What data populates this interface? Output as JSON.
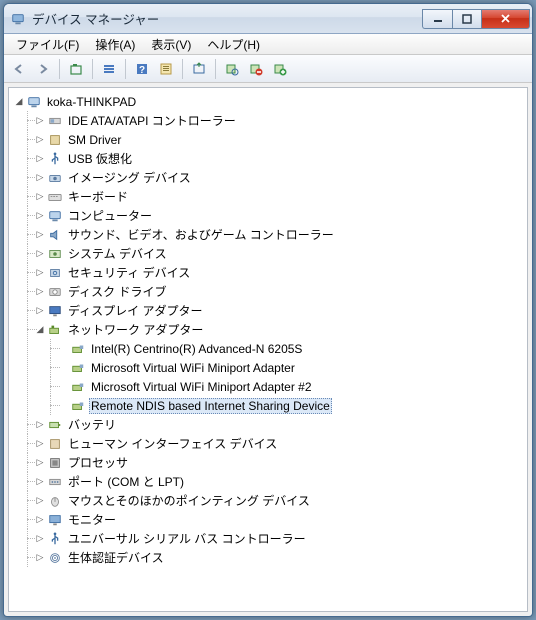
{
  "window": {
    "title": "デバイス マネージャー"
  },
  "menus": {
    "file": "ファイル(F)",
    "action": "操作(A)",
    "view": "表示(V)",
    "help": "ヘルプ(H)"
  },
  "toolbar_icons": [
    "back-icon",
    "forward-icon",
    "sep",
    "up-container-icon",
    "sep",
    "list-icon",
    "sep",
    "help-icon",
    "properties-icon",
    "sep",
    "refresh-icon",
    "sep",
    "scan-icon",
    "remove-icon",
    "add-icon"
  ],
  "tree": {
    "root": {
      "label": "koka-THINKPAD",
      "icon": "computer-icon",
      "expanded": true
    },
    "categories": [
      {
        "label": "IDE ATA/ATAPI コントローラー",
        "icon": "ide-icon"
      },
      {
        "label": "SM Driver",
        "icon": "sm-icon"
      },
      {
        "label": "USB 仮想化",
        "icon": "usb-icon"
      },
      {
        "label": "イメージング デバイス",
        "icon": "imaging-icon"
      },
      {
        "label": "キーボード",
        "icon": "keyboard-icon"
      },
      {
        "label": "コンピューター",
        "icon": "computer-icon"
      },
      {
        "label": "サウンド、ビデオ、およびゲーム コントローラー",
        "icon": "sound-icon"
      },
      {
        "label": "システム デバイス",
        "icon": "system-icon"
      },
      {
        "label": "セキュリティ デバイス",
        "icon": "security-icon"
      },
      {
        "label": "ディスク ドライブ",
        "icon": "disk-icon"
      },
      {
        "label": "ディスプレイ アダプター",
        "icon": "display-icon"
      },
      {
        "label": "ネットワーク アダプター",
        "icon": "network-icon",
        "expanded": true,
        "children": [
          {
            "label": "Intel(R) Centrino(R) Advanced-N 6205S",
            "icon": "netcard-icon"
          },
          {
            "label": "Microsoft Virtual WiFi Miniport Adapter",
            "icon": "netcard-icon"
          },
          {
            "label": "Microsoft Virtual WiFi Miniport Adapter #2",
            "icon": "netcard-icon"
          },
          {
            "label": "Remote NDIS based Internet Sharing Device",
            "icon": "netcard-icon",
            "selected": true
          }
        ]
      },
      {
        "label": "バッテリ",
        "icon": "battery-icon"
      },
      {
        "label": "ヒューマン インターフェイス デバイス",
        "icon": "hid-icon"
      },
      {
        "label": "プロセッサ",
        "icon": "cpu-icon"
      },
      {
        "label": "ポート (COM と LPT)",
        "icon": "port-icon"
      },
      {
        "label": "マウスとそのほかのポインティング デバイス",
        "icon": "mouse-icon"
      },
      {
        "label": "モニター",
        "icon": "monitor-icon"
      },
      {
        "label": "ユニバーサル シリアル バス コントローラー",
        "icon": "usb-icon"
      },
      {
        "label": "生体認証デバイス",
        "icon": "biometric-icon"
      }
    ]
  }
}
